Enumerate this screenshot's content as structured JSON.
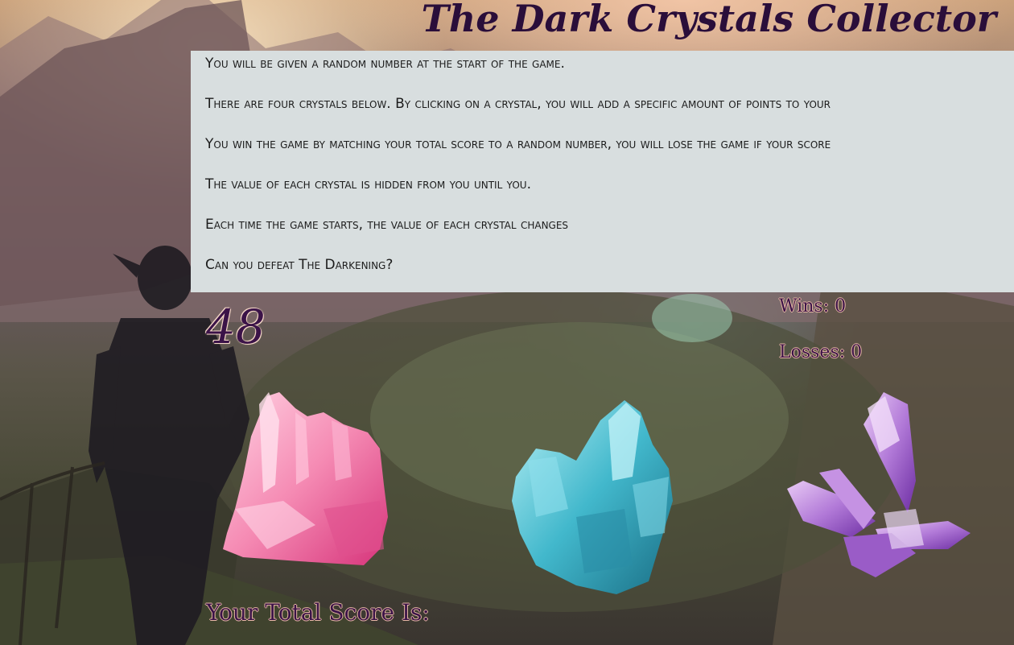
{
  "game": {
    "title": "The Dark Crystals Collector",
    "instructions": [
      "You will be given a random number at the start of the game.",
      "There are four crystals below. By clicking on a crystal, you will add a specific amount of points to your",
      "You win the game by matching your total score to a random number, you will lose the game if your score",
      "The value of each crystal is hidden from you until you.",
      "Each time the game starts, the value of each crystal changes",
      "Can you defeat The Darkening?"
    ],
    "random_number": "48",
    "wins_label": "Wins: 0",
    "losses_label": "Losses: 0",
    "total_score_label": "Your Total Score Is:",
    "crystals": [
      {
        "name": "pink-crystal",
        "color": "#f27aa8"
      },
      {
        "name": "blue-crystal",
        "color": "#3fb6c9"
      },
      {
        "name": "purple-crystal",
        "color": "#a56bd0"
      }
    ]
  },
  "colors": {
    "title": "#2a0e3a",
    "instructions_bg": "#d8dedf",
    "label_text": "#3b1348",
    "label_outline": "#e7b8a4"
  }
}
